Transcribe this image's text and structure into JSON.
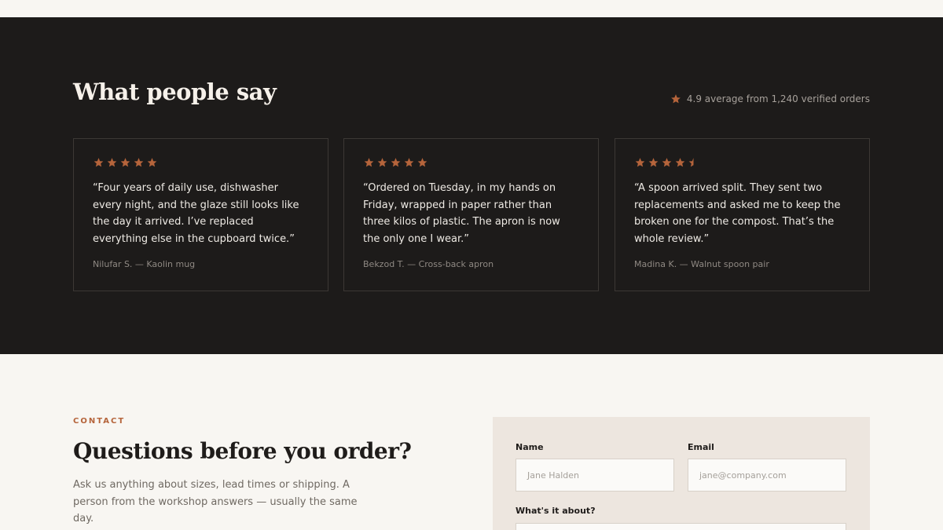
{
  "reviews": {
    "title": "What people say",
    "summary": "4.9 average from 1,240 verified orders",
    "accent_color": "#b5643b",
    "cards": [
      {
        "rating": 5,
        "quote": "“Four years of daily use, dishwasher every night, and the glaze still looks like the day it arrived. I’ve replaced everything else in the cupboard twice.”",
        "byline": "Nilufar S. — Kaolin mug"
      },
      {
        "rating": 5,
        "quote": "“Ordered on Tuesday, in my hands on Friday, wrapped in paper rather than three kilos of plastic. The apron is now the only one I wear.”",
        "byline": "Bekzod T. — Cross-back apron"
      },
      {
        "rating": 4.5,
        "quote": "“A spoon arrived split. They sent two replacements and asked me to keep the broken one for the compost. That’s the whole review.”",
        "byline": "Madina K. — Walnut spoon pair"
      }
    ]
  },
  "contact": {
    "eyebrow": "CONTACT",
    "title": "Questions before you order?",
    "description": "Ask us anything about sizes, lead times or shipping. A person from the workshop answers — usually the same day.",
    "form": {
      "name_label": "Name",
      "name_placeholder": "Jane Halden",
      "email_label": "Email",
      "email_placeholder": "jane@company.com",
      "topic_label": "What's it about?"
    }
  }
}
